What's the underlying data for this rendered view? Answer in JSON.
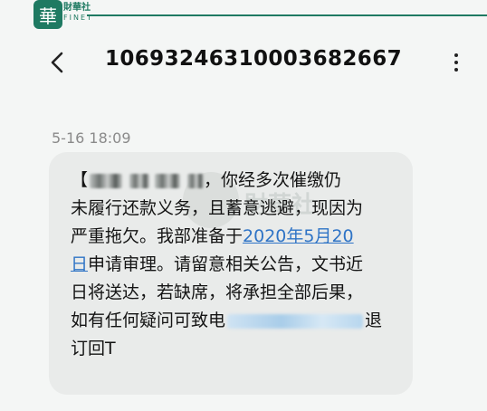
{
  "brand": {
    "logo_glyph": "華",
    "name_cn": "財華社",
    "name_en": "FINET",
    "color": "#1f7a62"
  },
  "header": {
    "back_icon": "chevron-left-icon",
    "sender_number": "10693246310003682667",
    "more_icon": "more-vertical-icon"
  },
  "message": {
    "timestamp": "5-16 18:09",
    "line1_start": "【",
    "line1_end": "，你经多次催缴仍",
    "line2": "未履行还款义务，且蓄意逃避，现因为",
    "line3_pre": "严重拖欠。我部准备于",
    "date_link_part1": "2020年5月20",
    "date_link_part2": "日",
    "line4_post": "申请审理。请留意相关公告，文书近",
    "line5": "日将送达，若缺席，将承担全部后果，",
    "line6_pre": "如有任何疑问可致电",
    "line6_post": "退",
    "line7": "订回T",
    "link_color": "#2f74c6",
    "bubble_color": "#e9ebea"
  },
  "watermark": {
    "text": "財華社"
  }
}
